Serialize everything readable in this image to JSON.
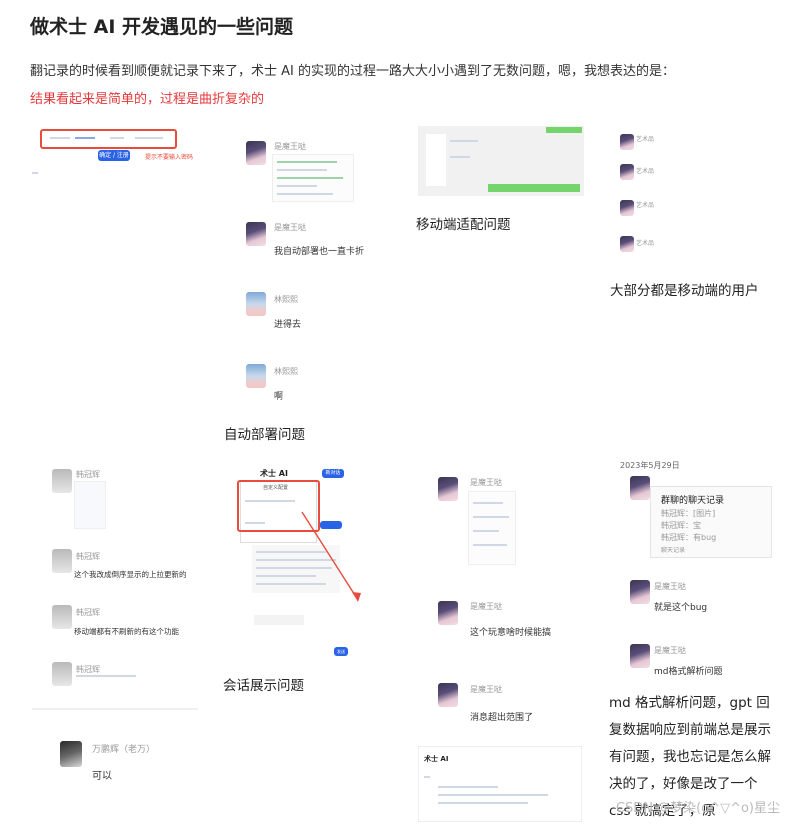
{
  "title": "做术士 AI 开发遇见的一些问题",
  "intro_line": "翻记录的时候看到顺便就记录下来了，术士 AI 的实现的过程一路大大小小遇到了无数问题，嗯，我想表达的是：",
  "intro_highlight": "结果看起来是简单的，过程是曲折复杂的",
  "captions": {
    "mobile_adapt": "移动端适配问题",
    "mostly_mobile": "大部分都是移动端的用户",
    "auto_deploy": "自动部署问题",
    "chat_display": "会话展示问题",
    "md_parse": "md 格式解析问题，gpt 回复数据响应到前端总是展示有问题，我也忘记是怎么解决的了，好像是改了一个 css 就搞定了，原"
  },
  "shot1": {
    "btn": "确定 / 注册",
    "red_note": "提示不要输入密码"
  },
  "shot2": {
    "m1_name": "是魔王哒",
    "m2_name": "是魔王哒",
    "m2_text": "我自动部署也一直卡折",
    "m3_name": "林熙熙",
    "m3_text": "进得去",
    "m4_name": "林熙熙",
    "m4_text": "啊"
  },
  "shot4": {
    "n1": "艺术品",
    "n2": "艺术品",
    "n3": "艺术品",
    "n4": "艺术品"
  },
  "shot5": {
    "n1": "韩冠辉",
    "n2": "韩冠辉",
    "t2": "这个我改成倒序显示的上拉更新的",
    "n3": "韩冠辉",
    "t3": "移动端都有不刷新的有这个功能",
    "n4": "韩冠辉",
    "n5": "万鹏辉（老万）",
    "t5": "可以"
  },
  "shot6": {
    "app": "术士 AI",
    "btn": "新对话",
    "box_title": "自定义配置",
    "send": "发送"
  },
  "shot7": {
    "n1": "是魔王哒",
    "n2": "是魔王哒",
    "t2": "这个玩意啥时候能搞",
    "n3": "是魔王哒",
    "t3": "消息超出范围了"
  },
  "shot8": {
    "date": "2023年5月29日",
    "card_title": "群聊的聊天记录",
    "card_lines": [
      "韩冠辉：[图片]",
      "韩冠辉：宝",
      "韩冠辉：有bug"
    ],
    "card_foot": "聊天记录",
    "n2": "是魔王哒",
    "t2": "就是这个bug",
    "n3": "是魔王哒",
    "t3": "md格式解析问题"
  },
  "shot9": {
    "app": "术士 AI"
  },
  "watermark": "CSDN @梦染(o^▽^o)星尘"
}
